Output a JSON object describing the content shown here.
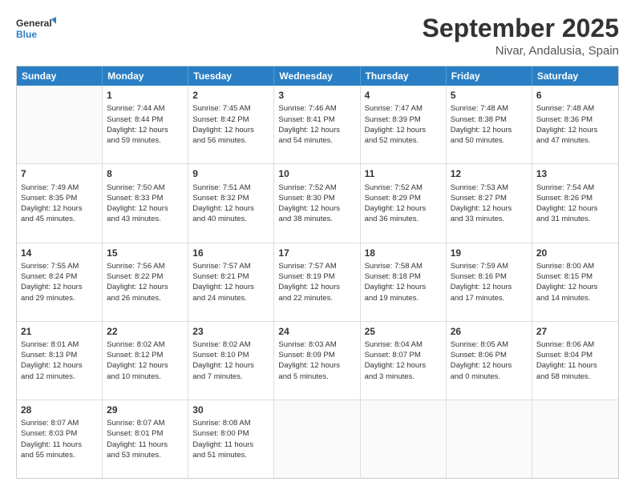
{
  "logo": {
    "text_general": "General",
    "text_blue": "Blue"
  },
  "header": {
    "title": "September 2025",
    "subtitle": "Nivar, Andalusia, Spain"
  },
  "days": [
    "Sunday",
    "Monday",
    "Tuesday",
    "Wednesday",
    "Thursday",
    "Friday",
    "Saturday"
  ],
  "weeks": [
    [
      {
        "day": "",
        "info": ""
      },
      {
        "day": "1",
        "info": "Sunrise: 7:44 AM\nSunset: 8:44 PM\nDaylight: 12 hours\nand 59 minutes."
      },
      {
        "day": "2",
        "info": "Sunrise: 7:45 AM\nSunset: 8:42 PM\nDaylight: 12 hours\nand 56 minutes."
      },
      {
        "day": "3",
        "info": "Sunrise: 7:46 AM\nSunset: 8:41 PM\nDaylight: 12 hours\nand 54 minutes."
      },
      {
        "day": "4",
        "info": "Sunrise: 7:47 AM\nSunset: 8:39 PM\nDaylight: 12 hours\nand 52 minutes."
      },
      {
        "day": "5",
        "info": "Sunrise: 7:48 AM\nSunset: 8:38 PM\nDaylight: 12 hours\nand 50 minutes."
      },
      {
        "day": "6",
        "info": "Sunrise: 7:48 AM\nSunset: 8:36 PM\nDaylight: 12 hours\nand 47 minutes."
      }
    ],
    [
      {
        "day": "7",
        "info": "Sunrise: 7:49 AM\nSunset: 8:35 PM\nDaylight: 12 hours\nand 45 minutes."
      },
      {
        "day": "8",
        "info": "Sunrise: 7:50 AM\nSunset: 8:33 PM\nDaylight: 12 hours\nand 43 minutes."
      },
      {
        "day": "9",
        "info": "Sunrise: 7:51 AM\nSunset: 8:32 PM\nDaylight: 12 hours\nand 40 minutes."
      },
      {
        "day": "10",
        "info": "Sunrise: 7:52 AM\nSunset: 8:30 PM\nDaylight: 12 hours\nand 38 minutes."
      },
      {
        "day": "11",
        "info": "Sunrise: 7:52 AM\nSunset: 8:29 PM\nDaylight: 12 hours\nand 36 minutes."
      },
      {
        "day": "12",
        "info": "Sunrise: 7:53 AM\nSunset: 8:27 PM\nDaylight: 12 hours\nand 33 minutes."
      },
      {
        "day": "13",
        "info": "Sunrise: 7:54 AM\nSunset: 8:26 PM\nDaylight: 12 hours\nand 31 minutes."
      }
    ],
    [
      {
        "day": "14",
        "info": "Sunrise: 7:55 AM\nSunset: 8:24 PM\nDaylight: 12 hours\nand 29 minutes."
      },
      {
        "day": "15",
        "info": "Sunrise: 7:56 AM\nSunset: 8:22 PM\nDaylight: 12 hours\nand 26 minutes."
      },
      {
        "day": "16",
        "info": "Sunrise: 7:57 AM\nSunset: 8:21 PM\nDaylight: 12 hours\nand 24 minutes."
      },
      {
        "day": "17",
        "info": "Sunrise: 7:57 AM\nSunset: 8:19 PM\nDaylight: 12 hours\nand 22 minutes."
      },
      {
        "day": "18",
        "info": "Sunrise: 7:58 AM\nSunset: 8:18 PM\nDaylight: 12 hours\nand 19 minutes."
      },
      {
        "day": "19",
        "info": "Sunrise: 7:59 AM\nSunset: 8:16 PM\nDaylight: 12 hours\nand 17 minutes."
      },
      {
        "day": "20",
        "info": "Sunrise: 8:00 AM\nSunset: 8:15 PM\nDaylight: 12 hours\nand 14 minutes."
      }
    ],
    [
      {
        "day": "21",
        "info": "Sunrise: 8:01 AM\nSunset: 8:13 PM\nDaylight: 12 hours\nand 12 minutes."
      },
      {
        "day": "22",
        "info": "Sunrise: 8:02 AM\nSunset: 8:12 PM\nDaylight: 12 hours\nand 10 minutes."
      },
      {
        "day": "23",
        "info": "Sunrise: 8:02 AM\nSunset: 8:10 PM\nDaylight: 12 hours\nand 7 minutes."
      },
      {
        "day": "24",
        "info": "Sunrise: 8:03 AM\nSunset: 8:09 PM\nDaylight: 12 hours\nand 5 minutes."
      },
      {
        "day": "25",
        "info": "Sunrise: 8:04 AM\nSunset: 8:07 PM\nDaylight: 12 hours\nand 3 minutes."
      },
      {
        "day": "26",
        "info": "Sunrise: 8:05 AM\nSunset: 8:06 PM\nDaylight: 12 hours\nand 0 minutes."
      },
      {
        "day": "27",
        "info": "Sunrise: 8:06 AM\nSunset: 8:04 PM\nDaylight: 11 hours\nand 58 minutes."
      }
    ],
    [
      {
        "day": "28",
        "info": "Sunrise: 8:07 AM\nSunset: 8:03 PM\nDaylight: 11 hours\nand 55 minutes."
      },
      {
        "day": "29",
        "info": "Sunrise: 8:07 AM\nSunset: 8:01 PM\nDaylight: 11 hours\nand 53 minutes."
      },
      {
        "day": "30",
        "info": "Sunrise: 8:08 AM\nSunset: 8:00 PM\nDaylight: 11 hours\nand 51 minutes."
      },
      {
        "day": "",
        "info": ""
      },
      {
        "day": "",
        "info": ""
      },
      {
        "day": "",
        "info": ""
      },
      {
        "day": "",
        "info": ""
      }
    ]
  ]
}
